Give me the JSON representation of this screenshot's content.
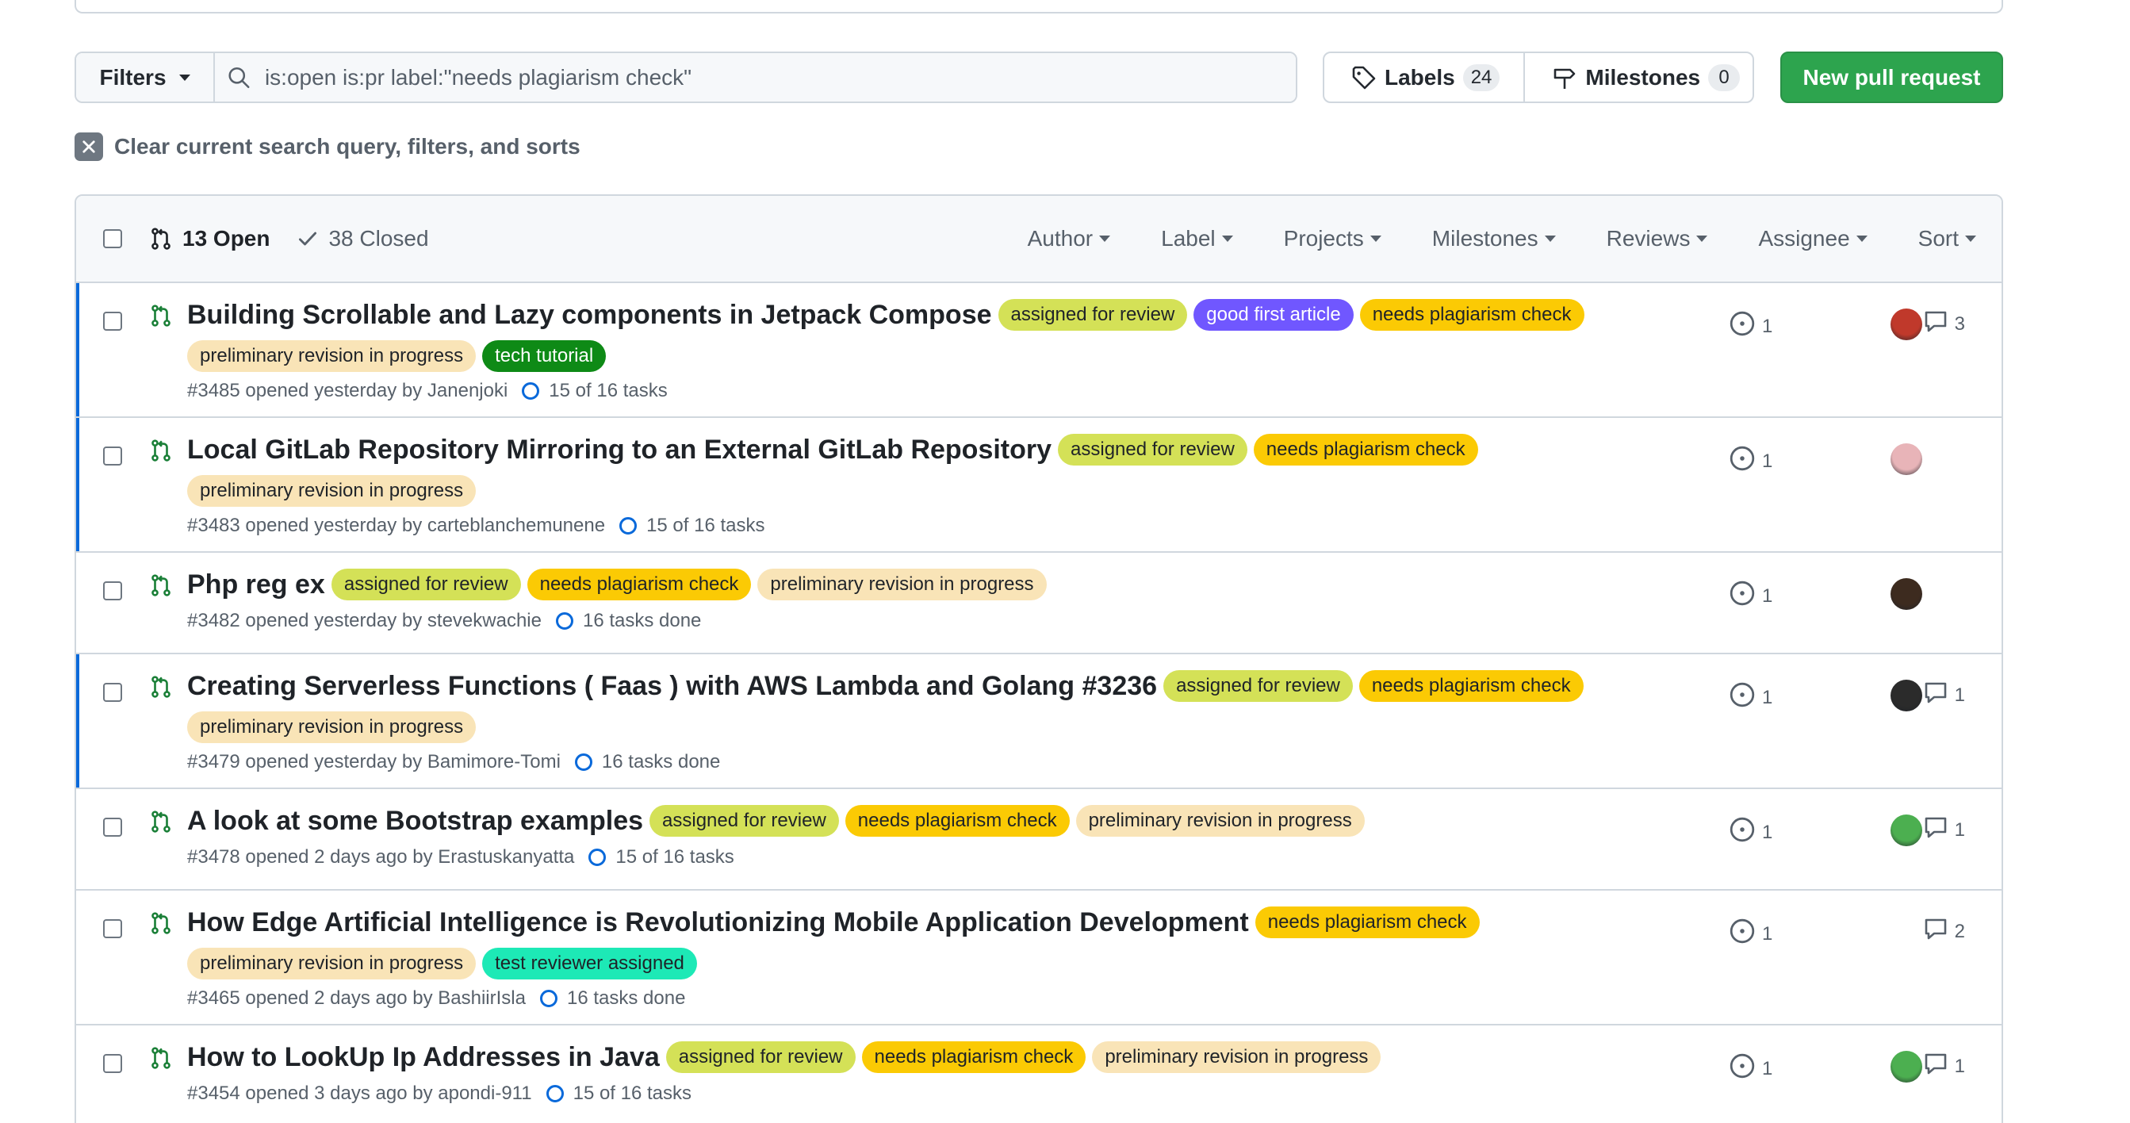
{
  "filters": {
    "label": "Filters"
  },
  "search": {
    "value": "is:open is:pr label:\"needs plagiarism check\""
  },
  "labels_btn": {
    "label": "Labels",
    "count": "24"
  },
  "milestones_btn": {
    "label": "Milestones",
    "count": "0"
  },
  "new_pr": {
    "label": "New pull request"
  },
  "clear": {
    "label": "Clear current search query, filters, and sorts"
  },
  "header": {
    "open": "13 Open",
    "closed": "38 Closed",
    "filters": [
      "Author",
      "Label",
      "Projects",
      "Milestones",
      "Reviews",
      "Assignee",
      "Sort"
    ]
  },
  "label_colors": {
    "assigned for review": {
      "bg": "#d4e157",
      "fg": "#1f2328"
    },
    "good first article": {
      "bg": "#7057ff",
      "fg": "#ffffff"
    },
    "needs plagiarism check": {
      "bg": "#fbca04",
      "fg": "#1f2328"
    },
    "preliminary revision in progress": {
      "bg": "#f9e4b7",
      "fg": "#1f2328"
    },
    "tech tutorial": {
      "bg": "#0e8a16",
      "fg": "#ffffff"
    },
    "test reviewer assigned": {
      "bg": "#1de9b6",
      "fg": "#1f2328"
    }
  },
  "prs": [
    {
      "title": "Building Scrollable and Lazy components in Jetpack Compose",
      "labels": [
        "assigned for review",
        "good first article",
        "needs plagiarism check",
        "preliminary revision in progress",
        "tech tutorial"
      ],
      "meta": "#3485 opened yesterday by Janenjoki",
      "tasks": "15 of 16 tasks",
      "issues": "1",
      "comments": "3",
      "avatar": "#c0392b",
      "unread": true
    },
    {
      "title": "Local GitLab Repository Mirroring to an External GitLab Repository",
      "labels": [
        "assigned for review",
        "needs plagiarism check",
        "preliminary revision in progress"
      ],
      "meta": "#3483 opened yesterday by carteblanchemunene",
      "tasks": "15 of 16 tasks",
      "issues": "1",
      "comments": "",
      "avatar": "#e8b4b8",
      "unread": true
    },
    {
      "title": "Php reg ex",
      "labels": [
        "assigned for review",
        "needs plagiarism check",
        "preliminary revision in progress"
      ],
      "meta": "#3482 opened yesterday by stevekwachie",
      "tasks": "16 tasks done",
      "issues": "1",
      "comments": "",
      "avatar": "#3d2b1f",
      "unread": false
    },
    {
      "title": "Creating Serverless Functions ( Faas ) with AWS Lambda and Golang #3236",
      "labels": [
        "assigned for review",
        "needs plagiarism check",
        "preliminary revision in progress"
      ],
      "meta": "#3479 opened yesterday by Bamimore-Tomi",
      "tasks": "16 tasks done",
      "issues": "1",
      "comments": "1",
      "avatar": "#2b2b2b",
      "unread": true
    },
    {
      "title": "A look at some Bootstrap examples",
      "labels": [
        "assigned for review",
        "needs plagiarism check",
        "preliminary revision in progress"
      ],
      "meta": "#3478 opened 2 days ago by Erastuskanyatta",
      "tasks": "15 of 16 tasks",
      "issues": "1",
      "comments": "1",
      "avatar": "#4caf50",
      "unread": false
    },
    {
      "title": "How Edge Artificial Intelligence is Revolutionizing Mobile Application Development",
      "labels": [
        "needs plagiarism check",
        "preliminary revision in progress",
        "test reviewer assigned"
      ],
      "meta": "#3465 opened 2 days ago by BashiirIsla",
      "tasks": "16 tasks done",
      "issues": "1",
      "comments": "2",
      "avatar": "",
      "unread": false
    },
    {
      "title": "How to LookUp Ip Addresses in Java",
      "labels": [
        "assigned for review",
        "needs plagiarism check",
        "preliminary revision in progress"
      ],
      "meta": "#3454 opened 3 days ago by apondi-911",
      "tasks": "15 of 16 tasks",
      "issues": "1",
      "comments": "1",
      "avatar": "#4caf50",
      "unread": false
    }
  ]
}
